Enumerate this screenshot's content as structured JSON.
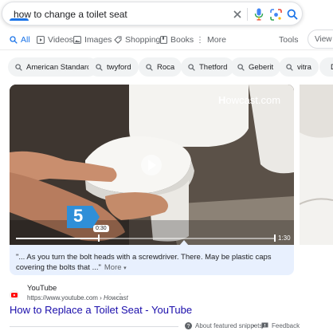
{
  "search": {
    "query": "how to change a toilet seat"
  },
  "tabs": [
    {
      "label": "All",
      "icon": "search-icon",
      "active": true
    },
    {
      "label": "Videos",
      "icon": "play-box-icon"
    },
    {
      "label": "Images",
      "icon": "image-icon"
    },
    {
      "label": "Shopping",
      "icon": "tag-icon"
    },
    {
      "label": "Books",
      "icon": "book-icon"
    },
    {
      "label": "More",
      "icon": "kebab-icon"
    }
  ],
  "tools_label": "Tools",
  "view_label": "View i",
  "chips": [
    "American Standard",
    "twyford",
    "Roca",
    "Thetford",
    "Geberit",
    "vitra",
    "D"
  ],
  "video": {
    "brand": "owcast.com",
    "brand_prefix": "H",
    "step_number": "5",
    "current_time": "0:30",
    "duration": "1:30",
    "progress": 0.32,
    "caption": "\"... As you turn the bolt heads with a screwdriver. There. May be plastic caps covering the bolts that ...\"",
    "more_label": "More"
  },
  "result": {
    "site_name": "YouTube",
    "url": "https://www.youtube.com",
    "source": "Howcast",
    "title": "How to Replace a Toilet Seat - YouTube"
  },
  "footer": {
    "about_label": "About featured snippets",
    "dot": "•",
    "feedback_label": "Feedback"
  },
  "colors": {
    "accent": "#1a73e8",
    "link": "#1a0dab",
    "chip_bg": "#f1f3f4",
    "card_bg": "#e8f0fe",
    "step_badge": "#2f8fd8"
  }
}
